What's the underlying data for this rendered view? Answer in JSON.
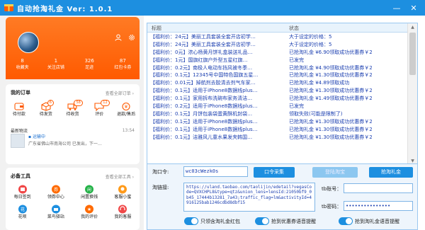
{
  "window": {
    "title": "自动抢淘礼金 Ver: 1.0.1",
    "minimize_icon": "minimize-icon",
    "close_icon": "close-icon"
  },
  "phone": {
    "stats": [
      {
        "num": "8",
        "label": "收藏夹"
      },
      {
        "num": "1",
        "label": "关注店铺"
      },
      {
        "num": "326",
        "label": "足迹"
      },
      {
        "num": "87",
        "label": "红包卡券"
      }
    ],
    "orders": {
      "title": "我的订单",
      "more": "查看全部订单 ›",
      "items": [
        {
          "label": "待付款",
          "badge": "",
          "icon": "wallet-icon"
        },
        {
          "label": "待发货",
          "badge": "6",
          "icon": "box-icon"
        },
        {
          "label": "待收货",
          "badge": "58",
          "icon": "truck-icon"
        },
        {
          "label": "评价",
          "badge": "12",
          "icon": "comment-icon"
        },
        {
          "label": "退款/售后",
          "badge": "",
          "icon": "refund-icon"
        }
      ],
      "logistics": {
        "title": "最新物流",
        "time": "13:54",
        "status": "运输中",
        "detail": "广东省佛山市南海公司 已发出，下一…"
      }
    },
    "tools": {
      "title": "必备工具",
      "more": "查看全部工具 ›",
      "items": [
        {
          "label": "每日签到",
          "icon": "calendar-icon",
          "color": "#f04848"
        },
        {
          "label": "领券中心",
          "icon": "coupon-icon",
          "color": "#ff6a00"
        },
        {
          "label": "闲置换钱",
          "icon": "recycle-icon",
          "color": "#26b34a"
        },
        {
          "label": "客服小蜜",
          "icon": "service-icon",
          "color": "#ff9a1a"
        },
        {
          "label": "花呗",
          "icon": "huabei-icon",
          "color": "#1d8fe0"
        },
        {
          "label": "菜鸟驿站",
          "icon": "station-icon",
          "color": "#1d8fe0"
        },
        {
          "label": "我的评价",
          "icon": "star-icon",
          "color": "#ff6a00"
        },
        {
          "label": "我的客服",
          "icon": "headset-icon",
          "color": "#f04848"
        }
      ]
    }
  },
  "messages": {
    "headers": {
      "title": "标题",
      "status": "状态"
    },
    "rows": [
      {
        "title": "【福利价：24元】美丽工具套装全套开店初学…",
        "status": "大于设定的价格：5"
      },
      {
        "title": "【福利价：24元】美丽工具套装全套开店初学…",
        "status": "大于设定的价格：5"
      },
      {
        "title": "【福利价：0元】浓心杨黄月饼礼盒装送礼品…",
        "status": "已抢淘礼金 ¥6.90领取成功优惠券￥2"
      },
      {
        "title": "【福利价：1元】国旗红旗户外型五星红旗…",
        "status": "已发完"
      },
      {
        "title": "【福利价：0.2元】南极人电动车挡风被冬季…",
        "status": "已抢淘礼金 ¥4.90领取成功优惠券￥2"
      },
      {
        "title": "【福利价：0.1元】12345号中国特色国旗五星…",
        "status": "已抢淘礼金 ¥1.30领取成功优惠券￥2"
      },
      {
        "title": "【福利价：0.01元】掉航剂去胶清去剂气车家…",
        "status": "已抢淘礼金 ¥4.89领取成功"
      },
      {
        "title": "【福利价：0.1元】适用于iPhone8数据线plus…",
        "status": "已抢淘礼金 ¥1.30领取成功优惠券￥2"
      },
      {
        "title": "【福利价：0.1元】家用拆布洗碗布家务清洁…",
        "status": "已抢淘礼金 ¥1.49领取成功优惠券￥2"
      },
      {
        "title": "【福利价：0.2元】适用于iPhone8数据线plus…",
        "status": "已发完"
      },
      {
        "title": "【福利价：0.1元】月饼包装袋蛋黄酥机封袋…",
        "status": "领取失败(可能是限制了)"
      },
      {
        "title": "【福利价：0.1元】适用于iPhone8数据线plus…",
        "status": "已抢淘礼金 ¥1.30领取成功优惠券￥2"
      },
      {
        "title": "【福利价：0.1元】适用于iPhone8数据线plus…",
        "status": "已抢淘礼金 ¥1.30领取成功优惠券￥2"
      },
      {
        "title": "【福利价：0.1元】洁雅风儿童水果发夹韩国…",
        "status": "已抢淘礼金 ¥1.30领取成功优惠券￥2"
      }
    ]
  },
  "form": {
    "taokou_label": "淘口令:",
    "taokou_value": "wc03cWezk0s",
    "btn_collect": "口令采集",
    "btn_login": "登陆淘宝",
    "btn_grab": "抢淘礼金",
    "link_label": "淘链接:",
    "link_value": "https://uland.taobao.com/taolijin/edetail?vegasCode=QVXCHPL8&type=qtz&union_lens=lensId:21050bf9_0b45_17444b13281_7a43;traffic_flag=lm&activityId=4916125bab1246cdbd8dbf15",
    "account_label": "tb账号：",
    "account_value": "",
    "password_label": "tb密码：",
    "password_value": "•••••••••••••••"
  },
  "toggles": [
    {
      "label": "只领含淘礼金红包",
      "on": true
    },
    {
      "label": "抢到优惠券语音提醒",
      "on": true
    },
    {
      "label": "抢到淘礼金语音提醒",
      "on": true
    }
  ],
  "colors": {
    "accent": "#1d8fe0",
    "profile": "#ff6a00"
  }
}
